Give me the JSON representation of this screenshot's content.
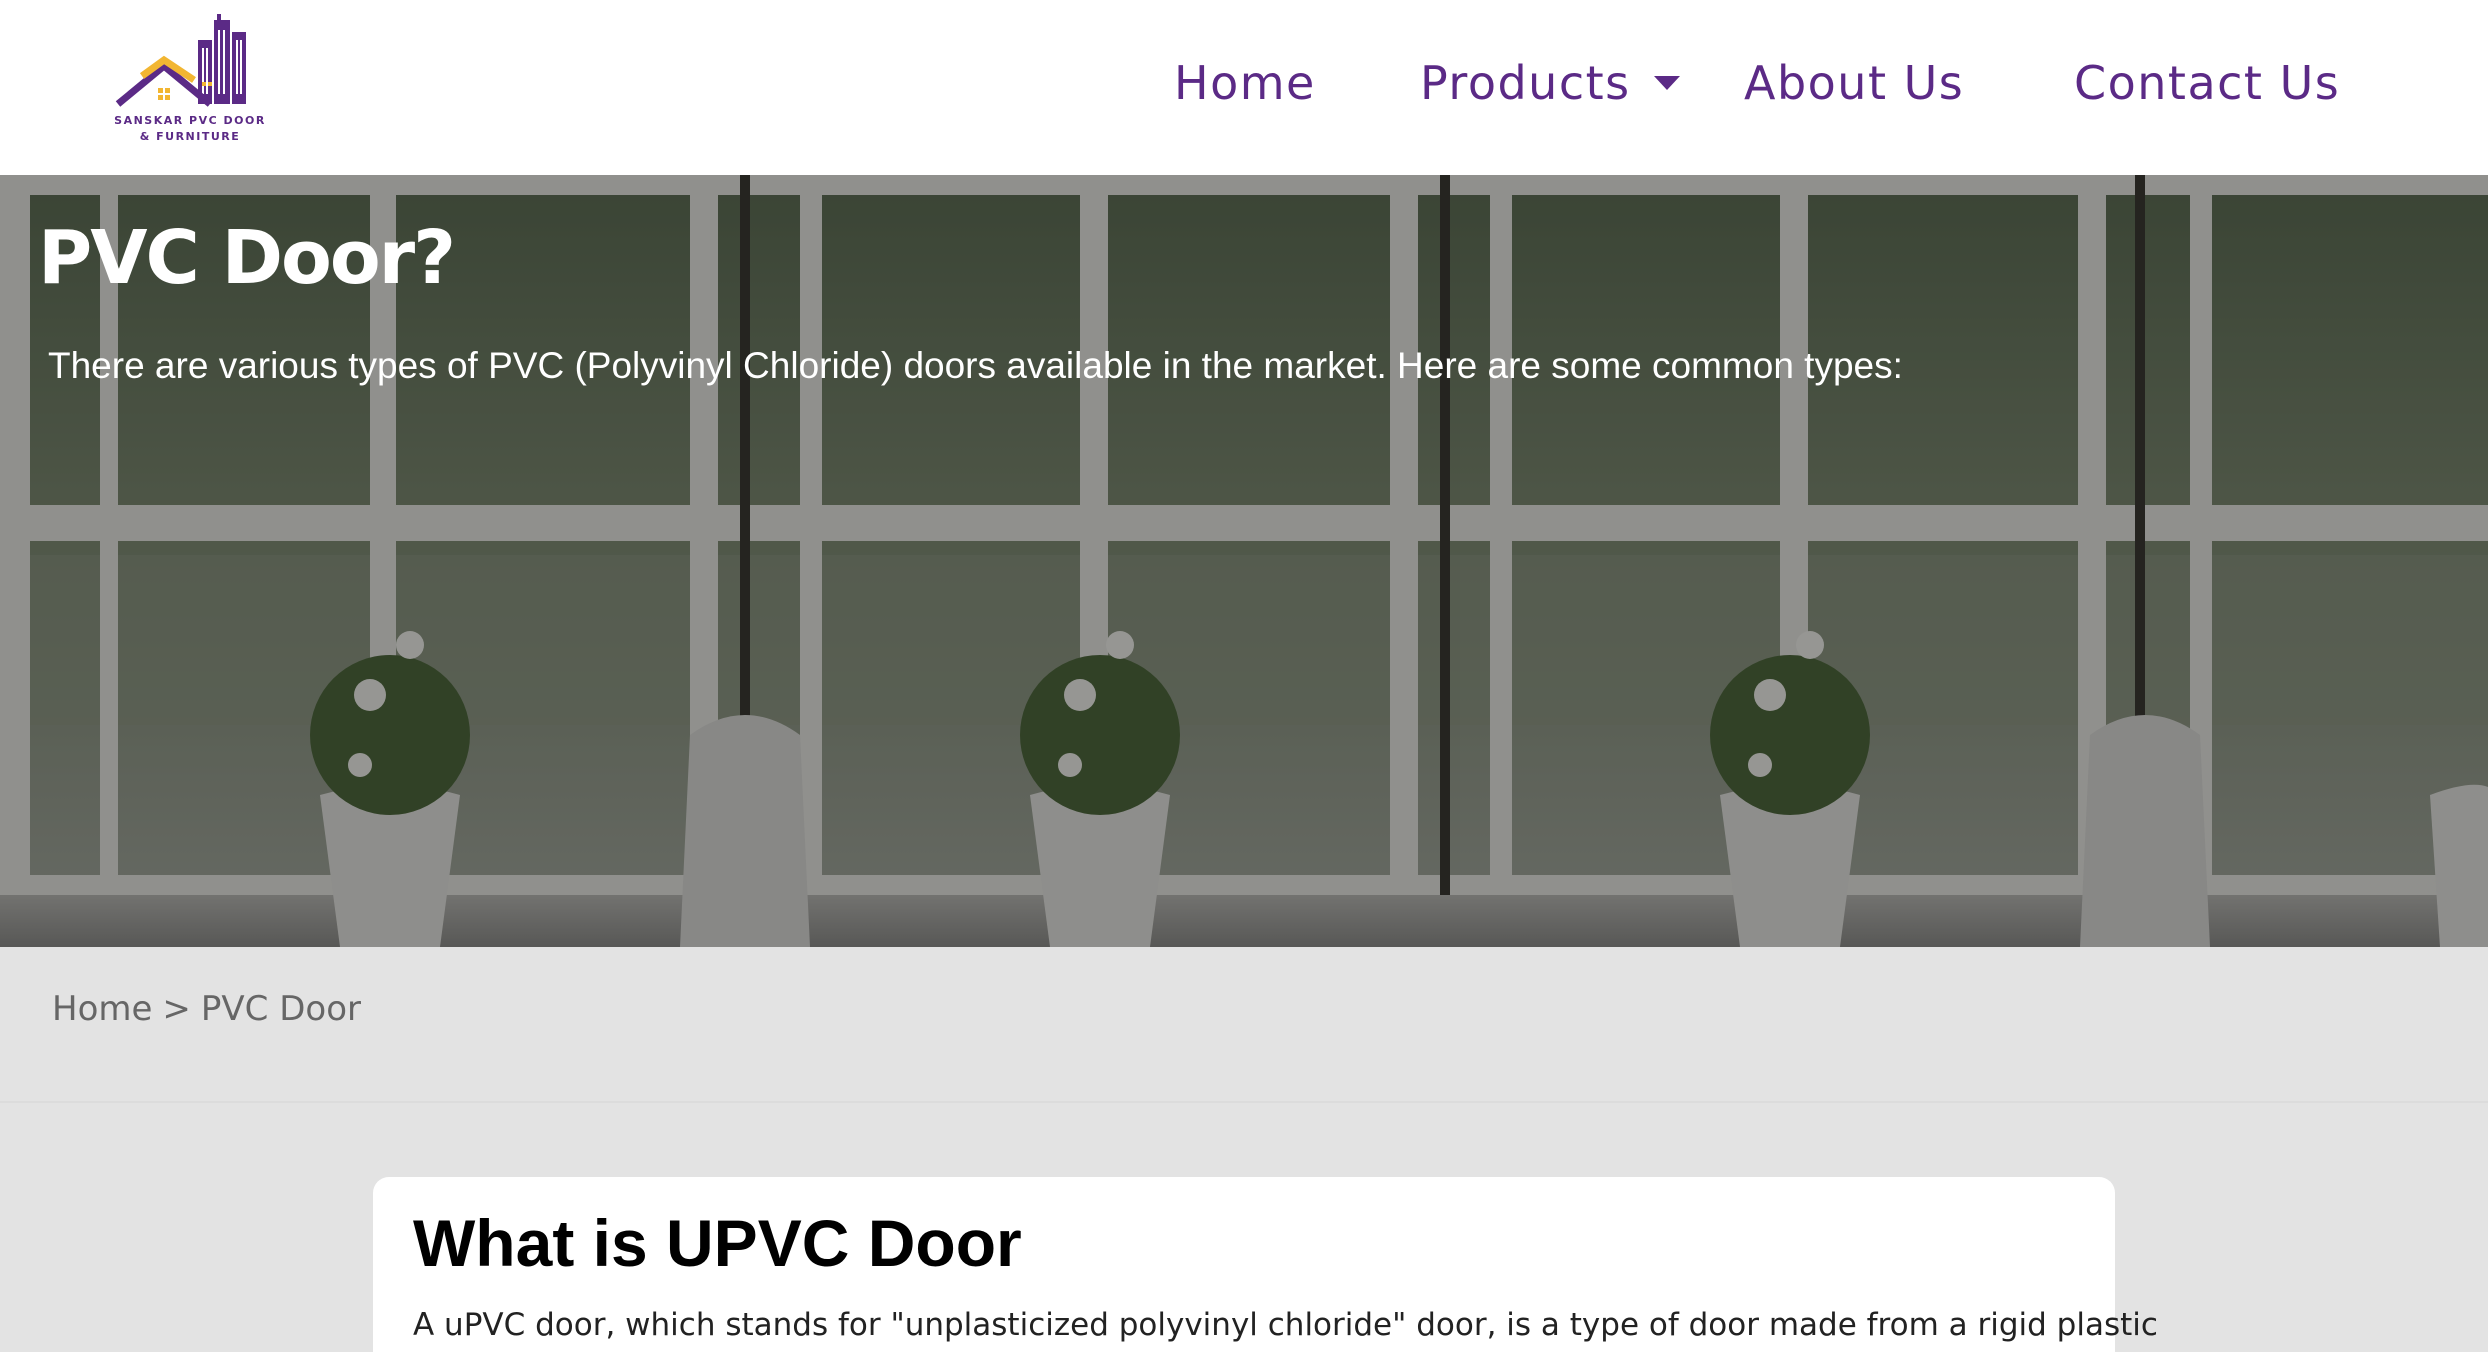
{
  "brand": {
    "line1": "SANSKAR PVC DOOR",
    "line2": "& FURNITURE",
    "colors": {
      "primary": "#5b2a86",
      "accent": "#f2b632"
    }
  },
  "nav": {
    "home": "Home",
    "products": "Products",
    "about": "About Us",
    "contact": "Contact Us"
  },
  "hero": {
    "title": "PVC Door?",
    "description": "There are various types of PVC (Polyvinyl Chloride) doors available in the market. Here are some common types:"
  },
  "breadcrumb": {
    "home": "Home",
    "separator": ">",
    "current": "PVC Door"
  },
  "card": {
    "title": "What is UPVC Door",
    "text": "A uPVC door, which stands for \"unplasticized polyvinyl chloride\" door, is a type of door made from a rigid plastic"
  }
}
